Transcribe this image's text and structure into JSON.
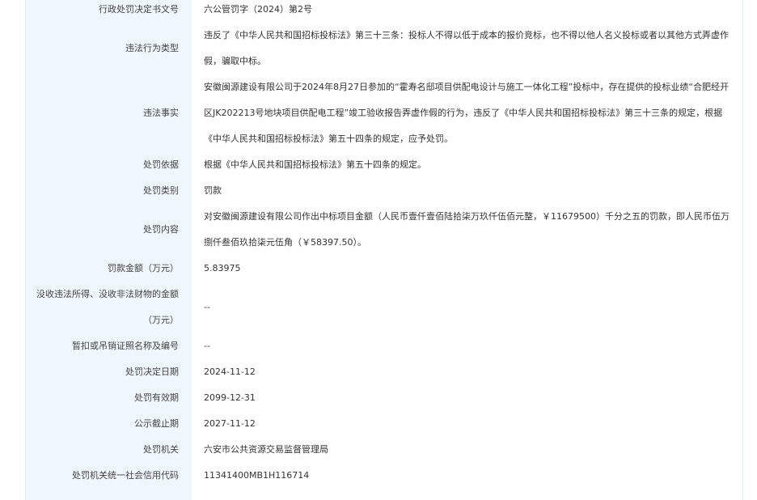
{
  "fields": [
    {
      "label": "行政处罚决定书文号",
      "value": "六公管罚字（2024）第2号"
    },
    {
      "label": "违法行为类型",
      "value": "违反了《中华人民共和国招标投标法》第三十三条：投标人不得以低于成本的报价竞标，也不得以他人名义投标或者以其他方式弄虚作假，骗取中标。"
    },
    {
      "label": "违法事实",
      "value": "安徽闽源建设有限公司于2024年8月27日参加的“霍寿名邸项目供配电设计与施工一体化工程”投标中，存在提供的投标业绩“合肥经开区JK202213号地块项目供配电工程”竣工验收报告弄虚作假的行为，违反了《中华人民共和国招标投标法》第三十三条的规定，根据《中华人民共和国招标投标法》第五十四条的规定，应予处罚。"
    },
    {
      "label": "处罚依据",
      "value": "根据《中华人民共和国招标投标法》第五十四条的规定。"
    },
    {
      "label": "处罚类别",
      "value": "罚款"
    },
    {
      "label": "处罚内容",
      "value": "对安徽闽源建设有限公司作出中标项目金额（人民币壹仟壹佰陆拾柒万玖仟伍佰元整，￥11679500）千分之五的罚款，即人民币伍万捌仟叁佰玖拾柒元伍角（￥58397.50）。"
    },
    {
      "label": "罚款金额（万元）",
      "value": "5.83975"
    },
    {
      "label": "没收违法所得、没收非法财物的金额（万元）",
      "value": "--"
    },
    {
      "label": "暂扣或吊销证照名称及编号",
      "value": "--"
    },
    {
      "label": "处罚决定日期",
      "value": "2024-11-12"
    },
    {
      "label": "处罚有效期",
      "value": "2099-12-31"
    },
    {
      "label": "公示截止期",
      "value": "2027-11-12"
    },
    {
      "label": "处罚机关",
      "value": "六安市公共资源交易监督管理局"
    },
    {
      "label": "处罚机关统一社会信用代码",
      "value": "11341400MB1H116714"
    }
  ]
}
